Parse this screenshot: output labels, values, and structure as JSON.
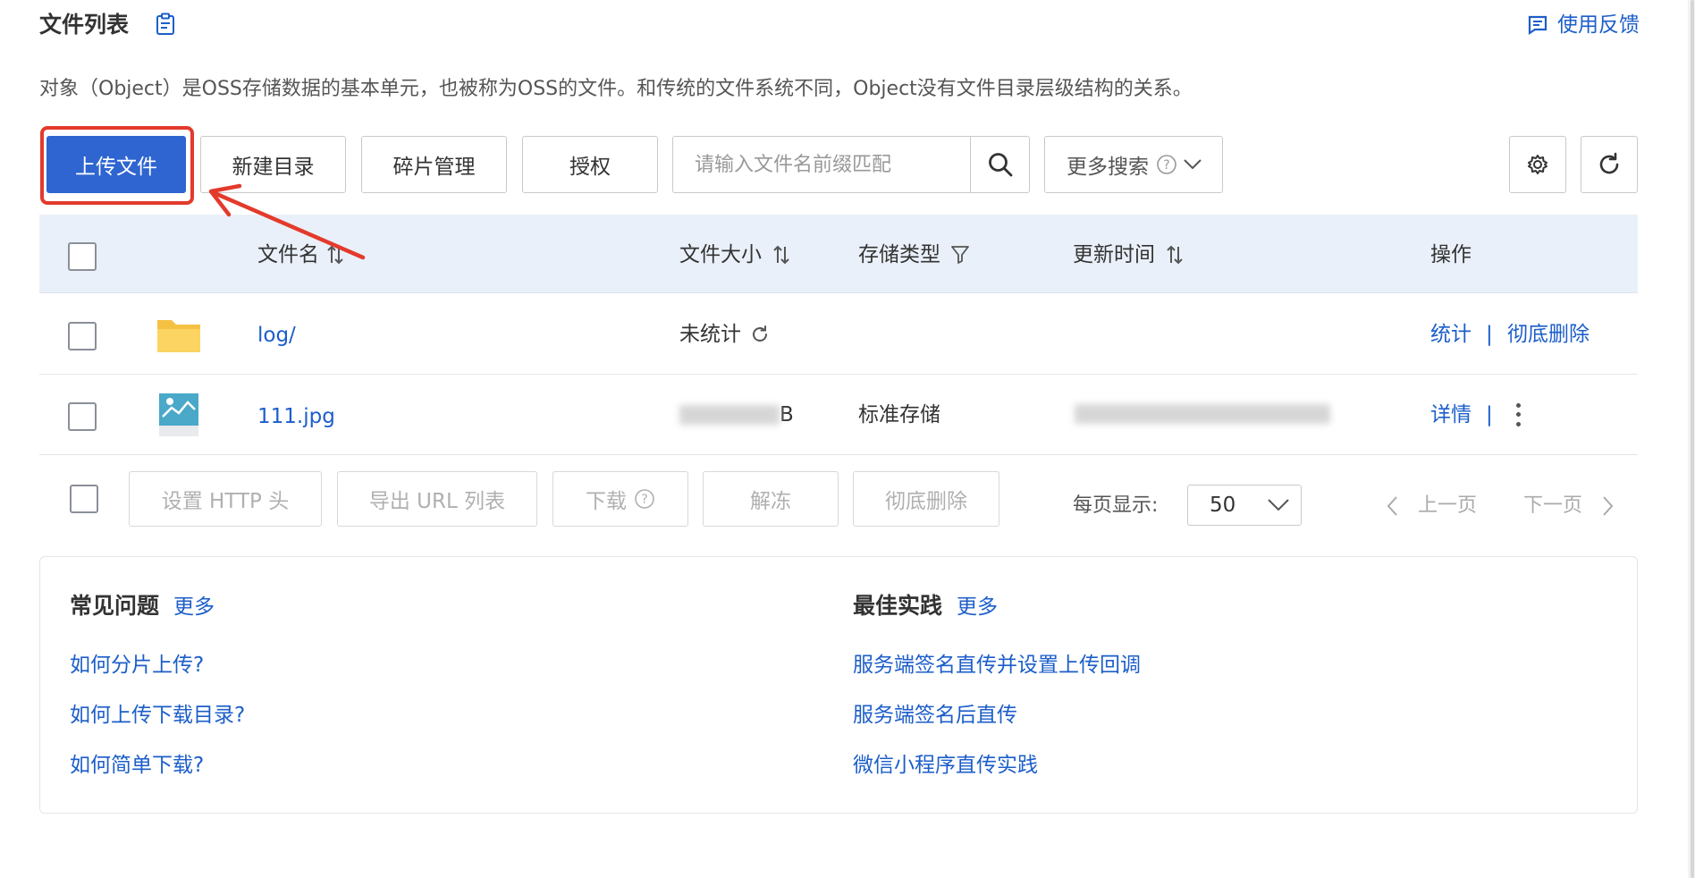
{
  "header": {
    "title": "文件列表",
    "feedback": "使用反馈",
    "description": "对象（Object）是OSS存储数据的基本单元，也被称为OSS的文件。和传统的文件系统不同，Object没有文件目录层级结构的关系。"
  },
  "toolbar": {
    "upload": "上传文件",
    "new_dir": "新建目录",
    "fragments": "碎片管理",
    "authorize": "授权",
    "search_placeholder": "请输入文件名前缀匹配",
    "more_search": "更多搜索"
  },
  "table": {
    "headers": {
      "name": "文件名",
      "size": "文件大小",
      "storage": "存储类型",
      "updated": "更新时间",
      "actions": "操作"
    },
    "rows": [
      {
        "name": "log/",
        "icon": "folder-icon",
        "size": "未统计",
        "storage": "",
        "updated": "",
        "action1": "统计",
        "separator": "|",
        "action2": "彻底删除"
      },
      {
        "name": "111.jpg",
        "icon": "image-file-icon",
        "size": "B",
        "storage": "标准存储",
        "updated": "",
        "action1": "详情",
        "separator": "|"
      }
    ]
  },
  "batch": {
    "set_http_header": "设置 HTTP 头",
    "export_url": "导出 URL 列表",
    "download": "下载",
    "unfreeze": "解冻",
    "delete": "彻底删除"
  },
  "pagination": {
    "per_page_label": "每页显示:",
    "per_page": "50",
    "prev": "上一页",
    "next": "下一页"
  },
  "help": {
    "faq_title": "常见问题",
    "faq_more": "更多",
    "faq_links": [
      "如何分片上传?",
      "如何上传下载目录?",
      "如何简单下载?"
    ],
    "practice_title": "最佳实践",
    "practice_more": "更多",
    "practice_links": [
      "服务端签名直传并设置上传回调",
      "服务端签名后直传",
      "微信小程序直传实践"
    ]
  },
  "colors": {
    "primary": "#2e65d0",
    "link": "#1c5ec9",
    "annotation": "#e33a2c",
    "header_bg": "#eaf0f9"
  }
}
